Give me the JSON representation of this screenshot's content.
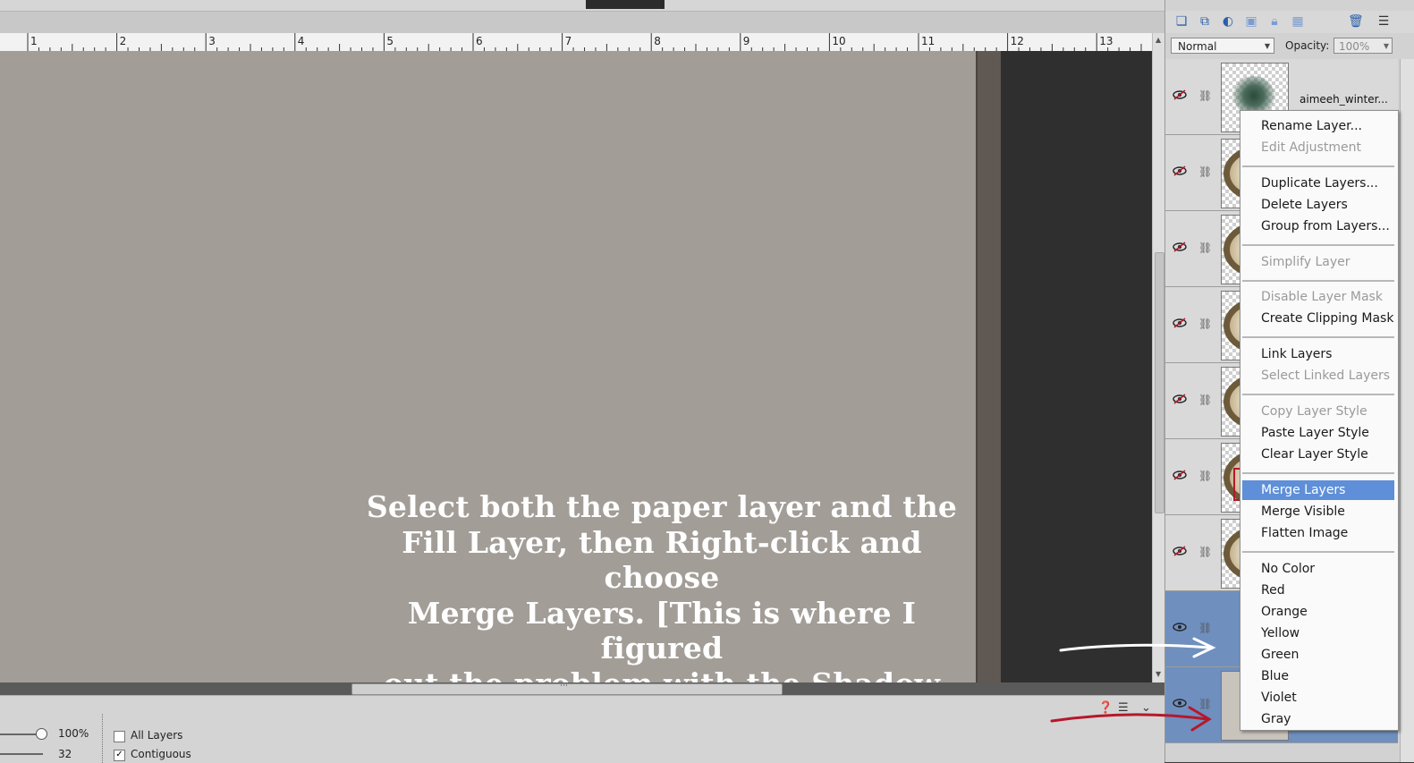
{
  "ruler": {
    "numbers": [
      "1",
      "2",
      "3",
      "4",
      "5",
      "6",
      "7",
      "8",
      "9",
      "10",
      "11",
      "12",
      "13"
    ]
  },
  "canvas": {
    "caption_lines": [
      "Select both the paper layer and the",
      "Fill Layer, then Right-click and choose",
      "Merge Layers. [This is where I figured",
      "out the problem with the Shadow Styles.]"
    ]
  },
  "options": {
    "zoom_value": "100%",
    "size_value": "32",
    "all_layers_label": "All Layers",
    "contiguous_label": "Contiguous",
    "all_layers_checked": false,
    "contiguous_checked": true
  },
  "panel": {
    "blend_mode": "Normal",
    "opacity_label": "Opacity:",
    "opacity_value": "100%",
    "layers": [
      {
        "name": "aimeeh_winter...",
        "visible": false,
        "thumb": "texture",
        "selected": false
      },
      {
        "name": "",
        "visible": false,
        "thumb": "frame",
        "selected": false
      },
      {
        "name": "",
        "visible": false,
        "thumb": "frame",
        "selected": false
      },
      {
        "name": "",
        "visible": false,
        "thumb": "frame",
        "selected": false
      },
      {
        "name": "",
        "visible": false,
        "thumb": "frame",
        "selected": false
      },
      {
        "name": "",
        "visible": false,
        "thumb": "frame",
        "selected": false
      },
      {
        "name": "",
        "visible": false,
        "thumb": "frame",
        "selected": false
      },
      {
        "name": "",
        "visible": true,
        "thumb": "fill",
        "selected": true
      },
      {
        "name": "",
        "visible": true,
        "thumb": "paper",
        "selected": true
      }
    ]
  },
  "context_menu": {
    "items": [
      {
        "label": "Rename Layer...",
        "enabled": true
      },
      {
        "label": "Edit Adjustment",
        "enabled": false
      },
      {
        "sep": true
      },
      {
        "label": "Duplicate Layers...",
        "enabled": true
      },
      {
        "label": "Delete Layers",
        "enabled": true
      },
      {
        "label": "Group from Layers...",
        "enabled": true
      },
      {
        "sep": true
      },
      {
        "label": "Simplify Layer",
        "enabled": false
      },
      {
        "sep": true
      },
      {
        "label": "Disable Layer Mask",
        "enabled": false
      },
      {
        "label": "Create Clipping Mask",
        "enabled": true
      },
      {
        "sep": true
      },
      {
        "label": "Link Layers",
        "enabled": true
      },
      {
        "label": "Select Linked Layers",
        "enabled": false
      },
      {
        "sep": true
      },
      {
        "label": "Copy Layer Style",
        "enabled": false
      },
      {
        "label": "Paste Layer Style",
        "enabled": true
      },
      {
        "label": "Clear Layer Style",
        "enabled": true
      },
      {
        "sep": true
      },
      {
        "label": "Merge Layers",
        "enabled": true,
        "highlighted": true
      },
      {
        "label": "Merge Visible",
        "enabled": true
      },
      {
        "label": "Flatten Image",
        "enabled": true
      },
      {
        "sep": true
      },
      {
        "label": "No Color",
        "enabled": true
      },
      {
        "label": "Red",
        "enabled": true
      },
      {
        "label": "Orange",
        "enabled": true
      },
      {
        "label": "Yellow",
        "enabled": true
      },
      {
        "label": "Green",
        "enabled": true
      },
      {
        "label": "Blue",
        "enabled": true
      },
      {
        "label": "Violet",
        "enabled": true
      },
      {
        "label": "Gray",
        "enabled": true
      }
    ]
  },
  "colors": {
    "canvas_paper": "#a29d97",
    "selection_blue": "#6f8fbf",
    "menu_highlight": "#5e8fd8",
    "annotation_red": "#b5182b",
    "annotation_white": "#ffffff"
  },
  "icons": {
    "panel_toolbar": [
      "new-layer-icon",
      "new-group-icon",
      "new-fill-layer-icon",
      "add-mask-icon",
      "lock-all-icon",
      "lock-transparency-icon",
      "delete-layer-icon",
      "panel-menu-icon"
    ],
    "options_toolbar": [
      "help-icon",
      "options-menu-icon",
      "collapse-icon"
    ]
  }
}
